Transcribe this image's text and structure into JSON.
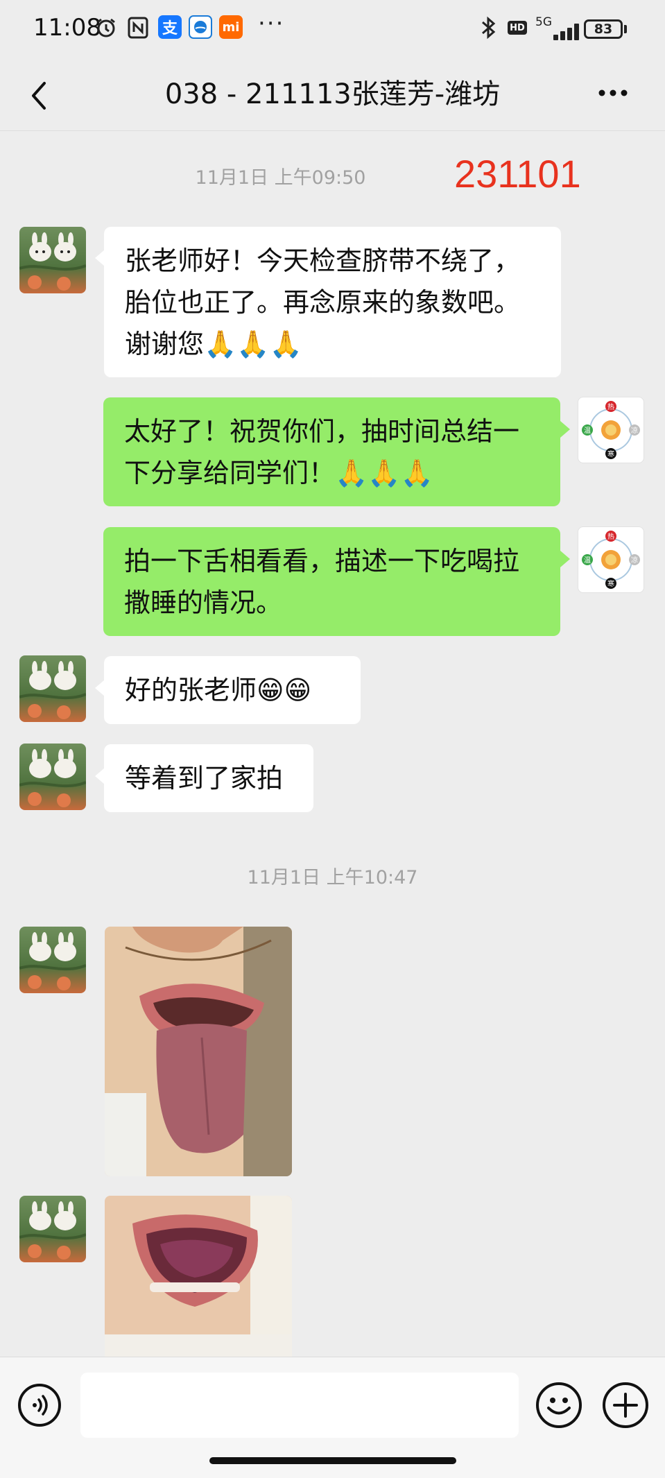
{
  "status_bar": {
    "time": "11:08",
    "network": "5G",
    "battery": "83"
  },
  "header": {
    "title": "038 - 211113张莲芳-潍坊"
  },
  "conversation": {
    "timestamp_1": "11月1日 上午09:50",
    "stamp_label": "231101",
    "messages": [
      {
        "side": "left",
        "text": "张老师好！今天检查脐带不绕了，胎位也正了。再念原来的象数吧。谢谢您🙏🙏🙏"
      },
      {
        "side": "right",
        "text": "太好了！祝贺你们，抽时间总结一下分享给同学们！🙏🙏🙏"
      },
      {
        "side": "right",
        "text": "拍一下舌相看看，描述一下吃喝拉撒睡的情况。"
      },
      {
        "side": "left",
        "text": "好的张老师😁😁"
      },
      {
        "side": "left",
        "text": "等着到了家拍"
      }
    ],
    "timestamp_2": "11月1日 上午10:47"
  },
  "avatar_right_labels": {
    "top": "热",
    "left": "温",
    "right": "凉",
    "bottom": "寒"
  },
  "colors": {
    "background": "#ededed",
    "outgoing_bubble": "#95ec69",
    "incoming_bubble": "#ffffff",
    "stamp_red": "#e8321e",
    "timestamp_gray": "#a1a1a1"
  },
  "icons": [
    "back-arrow-icon",
    "more-icon",
    "voice-icon",
    "emoji-icon",
    "plus-icon",
    "bluetooth-icon",
    "alarm-icon",
    "nfc-icon",
    "alipay-icon",
    "mi-icon"
  ]
}
